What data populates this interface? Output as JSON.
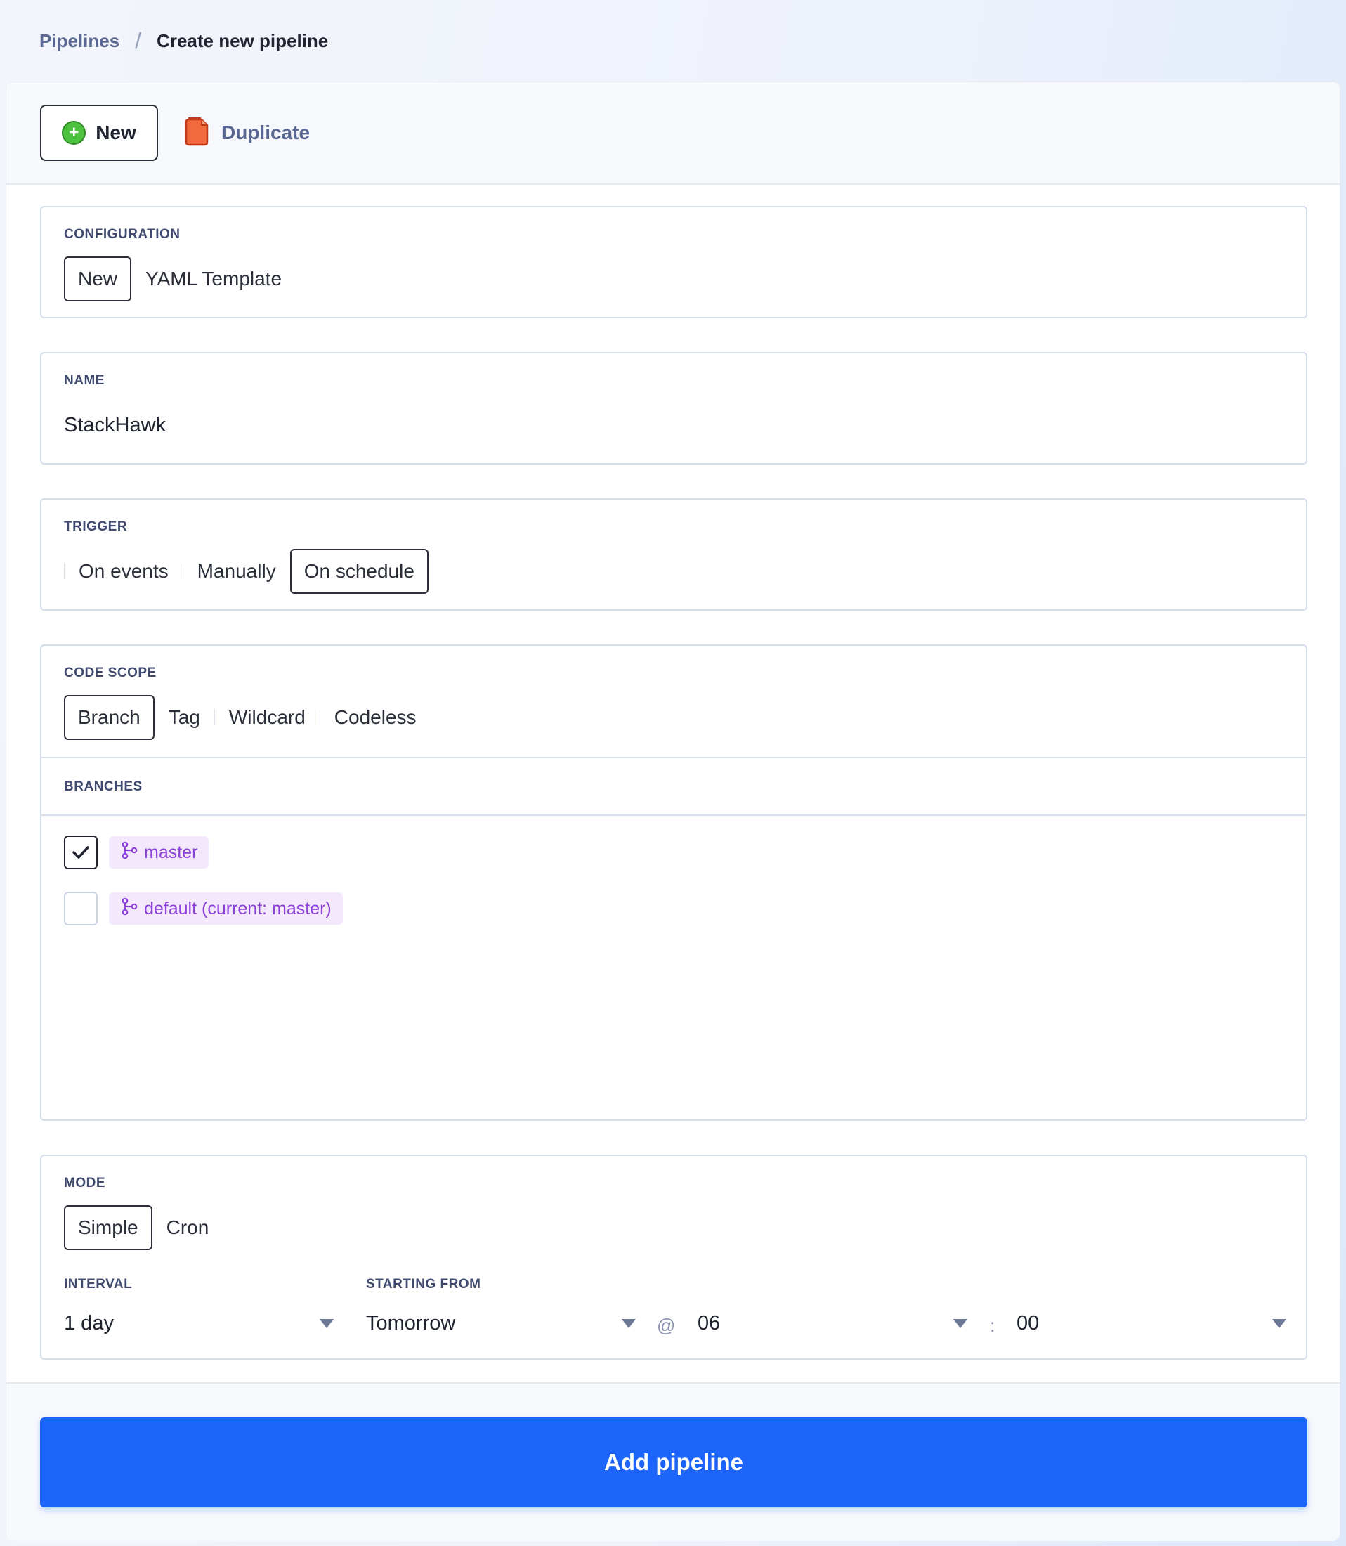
{
  "breadcrumb": {
    "parent": "Pipelines",
    "separator": "/",
    "current": "Create new pipeline"
  },
  "toolbar": {
    "new_label": "New",
    "duplicate_label": "Duplicate"
  },
  "configuration": {
    "label": "CONFIGURATION",
    "tabs": [
      "New",
      "YAML Template"
    ],
    "active": "New"
  },
  "name": {
    "label": "NAME",
    "value": "StackHawk"
  },
  "trigger": {
    "label": "TRIGGER",
    "tabs": [
      "On events",
      "Manually",
      "On schedule"
    ],
    "active": "On schedule"
  },
  "code_scope": {
    "label": "CODE SCOPE",
    "tabs": [
      "Branch",
      "Tag",
      "Wildcard",
      "Codeless"
    ],
    "active": "Branch",
    "branches_label": "BRANCHES",
    "branches": [
      {
        "name": "master",
        "checked": true
      },
      {
        "name": "default (current: master)",
        "checked": false
      }
    ]
  },
  "mode": {
    "label": "MODE",
    "tabs": [
      "Simple",
      "Cron"
    ],
    "active": "Simple",
    "interval_label": "INTERVAL",
    "interval_value": "1 day",
    "starting_label": "STARTING FROM",
    "starting_value": "Tomorrow",
    "at_symbol": "@",
    "hour_value": "06",
    "colon": ":",
    "minute_value": "00"
  },
  "submit_label": "Add pipeline",
  "colors": {
    "accent": "#1d64fb",
    "branch_pill": "#f4e8fd",
    "branch_text": "#8a3fd6"
  }
}
